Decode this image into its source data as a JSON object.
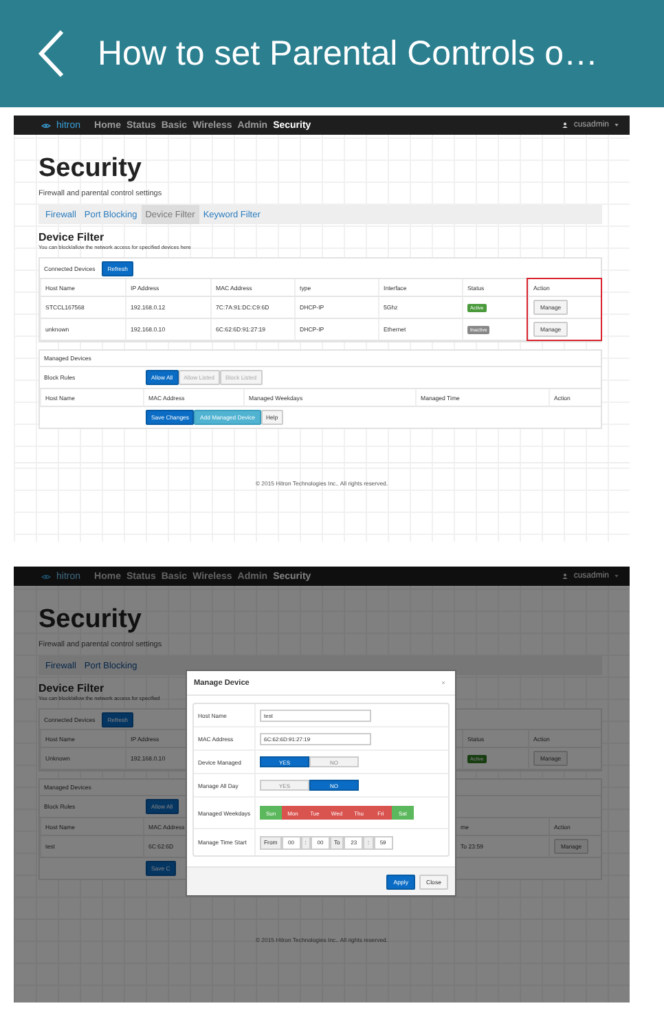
{
  "header": {
    "title": "How to set Parental Controls o…"
  },
  "screenshots": [
    {
      "dimmed": false,
      "brand": "hitron",
      "nav": [
        {
          "label": "Home",
          "selected": false
        },
        {
          "label": "Status",
          "selected": false
        },
        {
          "label": "Basic",
          "selected": false
        },
        {
          "label": "Wireless",
          "selected": false
        },
        {
          "label": "Admin",
          "selected": false
        },
        {
          "label": "Security",
          "selected": true
        }
      ],
      "user": "cusadmin",
      "title": "Security",
      "subtitle": "Firewall and parental control settings",
      "tabs": [
        {
          "label": "Firewall",
          "selected": false
        },
        {
          "label": "Port Blocking",
          "selected": false
        },
        {
          "label": "Device Filter",
          "selected": true
        },
        {
          "label": "Keyword Filter",
          "selected": false
        }
      ],
      "section_title": "Device Filter",
      "description": "You can block/allow the network access for specified devices here",
      "connected_devices": {
        "title": "Connected Devices",
        "refresh": "Refresh",
        "highlight_action_column": true,
        "columns": [
          "Host Name",
          "IP Address",
          "MAC Address",
          "type",
          "Interface",
          "Status",
          "Action"
        ],
        "rows": [
          {
            "cells": [
              "STCCL167568",
              "192.168.0.12",
              "7C:7A:91:DC:C9:6D",
              "DHCP-IP",
              "5Ghz"
            ],
            "status": {
              "label": "Active",
              "kind": "active"
            },
            "action": "Manage"
          },
          {
            "cells": [
              "unknown",
              "192.168.0.10",
              "6C:62:6D:91:27:19",
              "DHCP-IP",
              "Ethernet"
            ],
            "status": {
              "label": "Inactive",
              "kind": "inactive"
            },
            "action": "Manage"
          }
        ]
      },
      "managed_devices": {
        "title": "Managed Devices",
        "block_rules_label": "Block Rules",
        "rules": [
          {
            "label": "Allow All",
            "selected": true,
            "disabled": false
          },
          {
            "label": "Allow Listed",
            "selected": false,
            "disabled": true
          },
          {
            "label": "Block Listed",
            "selected": false,
            "disabled": true
          }
        ],
        "columns": [
          "Host Name",
          "MAC Address",
          "Managed Weekdays",
          "Managed Time",
          "Action"
        ],
        "buttons": [
          {
            "label": "Save Changes",
            "kind": "primary"
          },
          {
            "label": "Add Managed Device",
            "kind": "info"
          },
          {
            "label": "Help",
            "kind": "default"
          }
        ]
      },
      "footer": "© 2015 Hitron Technologies Inc.. All rights reserved."
    },
    {
      "dimmed": true,
      "brand": "hitron",
      "nav": [
        {
          "label": "Home",
          "selected": false
        },
        {
          "label": "Status",
          "selected": false
        },
        {
          "label": "Basic",
          "selected": false
        },
        {
          "label": "Wireless",
          "selected": false
        },
        {
          "label": "Admin",
          "selected": false
        },
        {
          "label": "Security",
          "selected": true
        }
      ],
      "user": "cusadmin",
      "title": "Security",
      "subtitle": "Firewall and parental control settings",
      "tabs": [
        {
          "label": "Firewall",
          "selected": false
        },
        {
          "label": "Port Blocking",
          "selected": false
        }
      ],
      "section_title": "Device Filter",
      "description": "You can block/allow the network access for specified",
      "connected_devices": {
        "title": "Connected Devices",
        "refresh": "Refresh",
        "highlight_action_column": false,
        "columns": [
          "Host Name",
          "IP Address",
          "Status",
          "Action"
        ],
        "rows": [
          {
            "cells": [
              "Unknown",
              "192.168.0.10"
            ],
            "status": {
              "label": "Active",
              "kind": "active"
            },
            "action": "Manage"
          }
        ]
      },
      "managed_devices": {
        "title": "Managed Devices",
        "block_rules_label": "Block Rules",
        "rules": [
          {
            "label": "Allow All",
            "selected": true,
            "disabled": false
          }
        ],
        "columns": [
          "Host Name",
          "MAC Address",
          "me",
          "Action"
        ],
        "rows": [
          {
            "cells": [
              "test",
              "6C:62:6D",
              "To 23:59"
            ],
            "action": "Manage"
          }
        ],
        "buttons": [
          {
            "label": "Save C",
            "kind": "primary"
          }
        ]
      },
      "footer": "© 2015 Hitron Technologies Inc.. All rights reserved.",
      "dialog": {
        "title": "Manage Device",
        "fields": [
          {
            "kind": "text",
            "label": "Host Name",
            "value": "test"
          },
          {
            "kind": "text",
            "label": "MAC Address",
            "value": "6C:62:6D:91:27:19"
          },
          {
            "kind": "toggle",
            "label": "Device Managed",
            "options": [
              {
                "label": "YES",
                "selected": true
              },
              {
                "label": "NO",
                "selected": false
              }
            ]
          },
          {
            "kind": "toggle",
            "label": "Manage All Day",
            "options": [
              {
                "label": "YES",
                "selected": false
              },
              {
                "label": "NO",
                "selected": true
              }
            ]
          },
          {
            "kind": "days",
            "label": "Managed Weekdays",
            "days": [
              {
                "label": "Sun",
                "selected": true
              },
              {
                "label": "Mon",
                "selected": false
              },
              {
                "label": "Tue",
                "selected": false
              },
              {
                "label": "Wed",
                "selected": false
              },
              {
                "label": "Thu",
                "selected": false
              },
              {
                "label": "Fri",
                "selected": false
              },
              {
                "label": "Sat",
                "selected": true
              }
            ]
          },
          {
            "kind": "time",
            "label": "Manage Time Start",
            "parts": [
              {
                "kind": "addon",
                "text": "From"
              },
              {
                "kind": "input",
                "text": "00"
              },
              {
                "kind": "addon",
                "text": ":"
              },
              {
                "kind": "input",
                "text": "00"
              },
              {
                "kind": "addon",
                "text": "To"
              },
              {
                "kind": "input",
                "text": "23"
              },
              {
                "kind": "addon",
                "text": ":"
              },
              {
                "kind": "input",
                "text": "59"
              }
            ]
          }
        ],
        "buttons": [
          {
            "label": "Apply",
            "kind": "primary"
          },
          {
            "label": "Close",
            "kind": "default"
          }
        ]
      }
    }
  ]
}
